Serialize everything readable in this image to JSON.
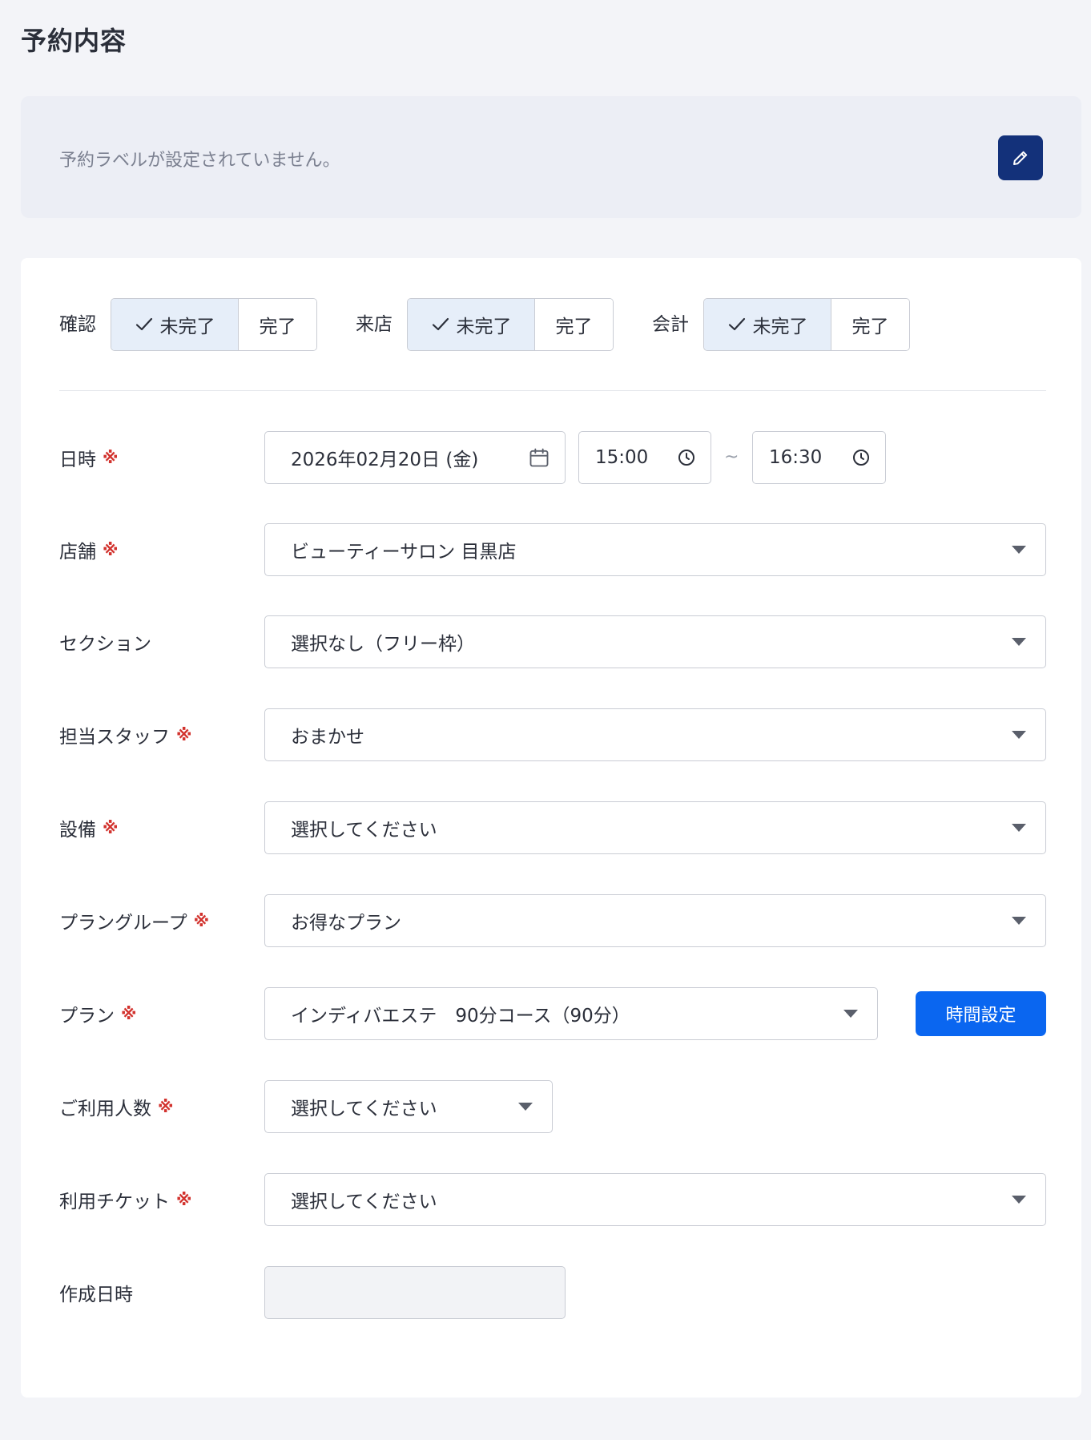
{
  "page": {
    "title": "予約内容"
  },
  "label_panel": {
    "message": "予約ラベルが設定されていません。",
    "edit_icon": "pencil-icon"
  },
  "status": {
    "groups": [
      {
        "label": "確認",
        "options": [
          "未完了",
          "完了"
        ],
        "selected": "未完了"
      },
      {
        "label": "来店",
        "options": [
          "未完了",
          "完了"
        ],
        "selected": "未完了"
      },
      {
        "label": "会計",
        "options": [
          "未完了",
          "完了"
        ],
        "selected": "未完了"
      }
    ],
    "check_icon": "check-icon"
  },
  "required_mark": "※",
  "fields": {
    "datetime": {
      "label": "日時",
      "date": "2026年02月20日 (金)",
      "start": "15:00",
      "separator": "~",
      "end": "16:30"
    },
    "store": {
      "label": "店舗",
      "value": "ビューティーサロン 目黒店"
    },
    "section": {
      "label": "セクション",
      "value": "選択なし（フリー枠）"
    },
    "staff": {
      "label": "担当スタッフ",
      "value": "おまかせ"
    },
    "equipment": {
      "label": "設備",
      "value": "選択してください"
    },
    "plan_group": {
      "label": "プラングループ",
      "value": "お得なプラン"
    },
    "plan": {
      "label": "プラン",
      "value": "インディバエステ　90分コース（90分）",
      "button": "時間設定"
    },
    "party_size": {
      "label": "ご利用人数",
      "value": "選択してください"
    },
    "ticket": {
      "label": "利用チケット",
      "value": "選択してください"
    },
    "created_at": {
      "label": "作成日時",
      "value": ""
    }
  },
  "colors": {
    "primary": "#0a66f0",
    "edit_button": "#13317a",
    "required": "#d2322d",
    "segment_active": "#e6eef9"
  }
}
